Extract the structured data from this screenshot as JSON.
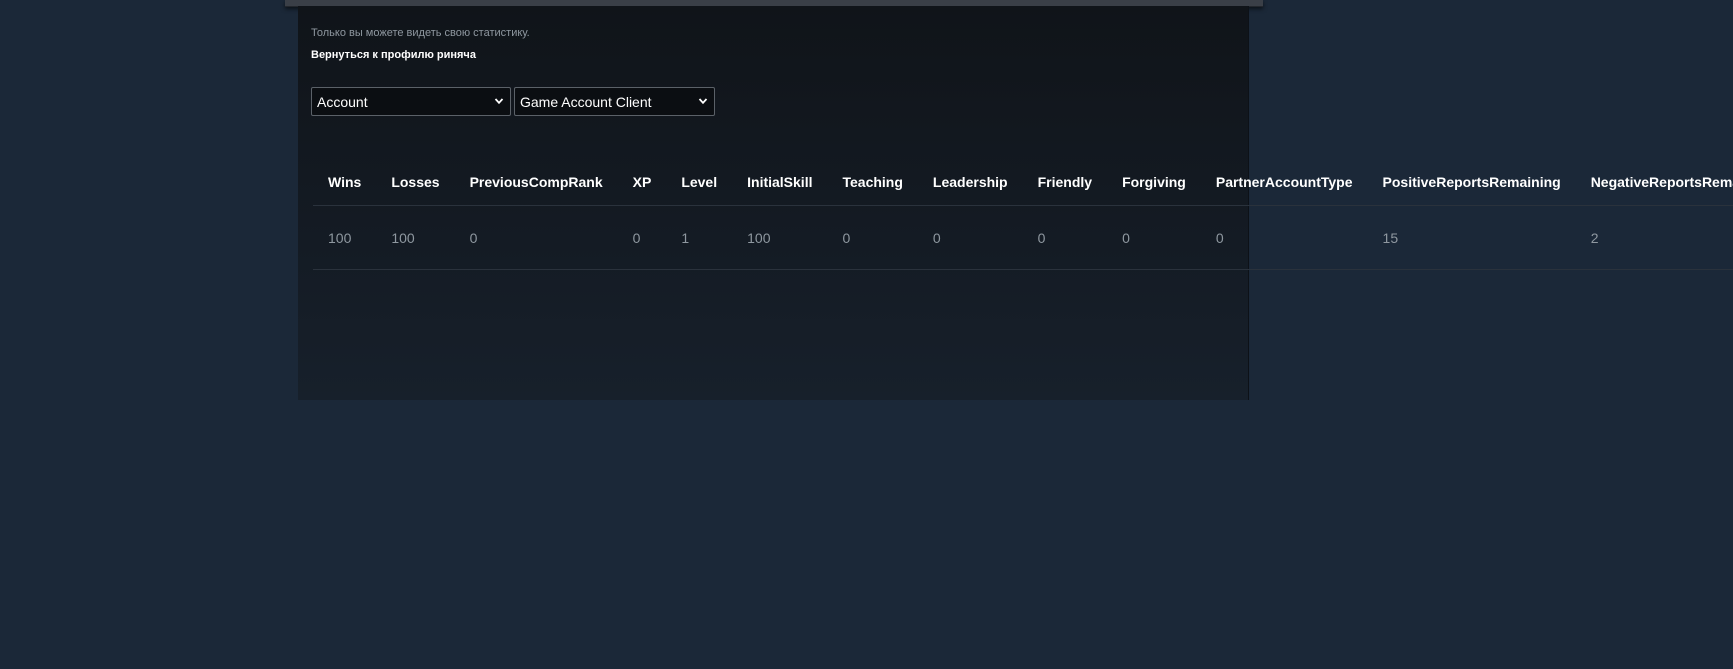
{
  "page": {
    "note": "Только вы можете видеть свою статистику.",
    "back_link": "Вернуться к профилю риняча"
  },
  "filters": {
    "category": {
      "selected": "Account"
    },
    "source": {
      "selected": "Game Account Client"
    }
  },
  "stats": {
    "columns": [
      "Wins",
      "Losses",
      "PreviousCompRank",
      "XP",
      "Level",
      "InitialSkill",
      "Teaching",
      "Leadership",
      "Friendly",
      "Forgiving",
      "PartnerAccountType",
      "PositiveReportsRemaining",
      "NegativeReportsRemaining"
    ],
    "rows": [
      [
        "100",
        "100",
        "0",
        "0",
        "1",
        "100",
        "0",
        "0",
        "0",
        "0",
        "0",
        "15",
        "2"
      ]
    ]
  },
  "colors": {
    "page_background": "#1b2838",
    "panel_background": "#121820",
    "header_text": "#ffffff",
    "cell_text": "#8f98a0"
  },
  "icons": {
    "dropdown": "chevron-down-icon"
  }
}
